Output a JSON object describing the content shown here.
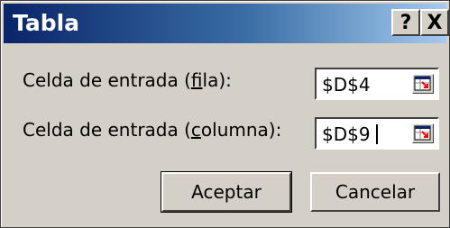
{
  "window": {
    "title": "Tabla",
    "help_button": "?",
    "close_button": "X"
  },
  "row_input": {
    "label_prefix": "Celda de entrada (",
    "label_accel": "f",
    "label_suffix": "ila):",
    "value": "$D$4",
    "button_icon": "collapse-dialog-icon"
  },
  "column_input": {
    "label_prefix": "Celda de entrada (",
    "label_accel": "c",
    "label_suffix": "olumna):",
    "value": "$D$9",
    "button_icon": "collapse-dialog-icon"
  },
  "buttons": {
    "ok_label": "Aceptar",
    "cancel_label": "Cancelar"
  }
}
